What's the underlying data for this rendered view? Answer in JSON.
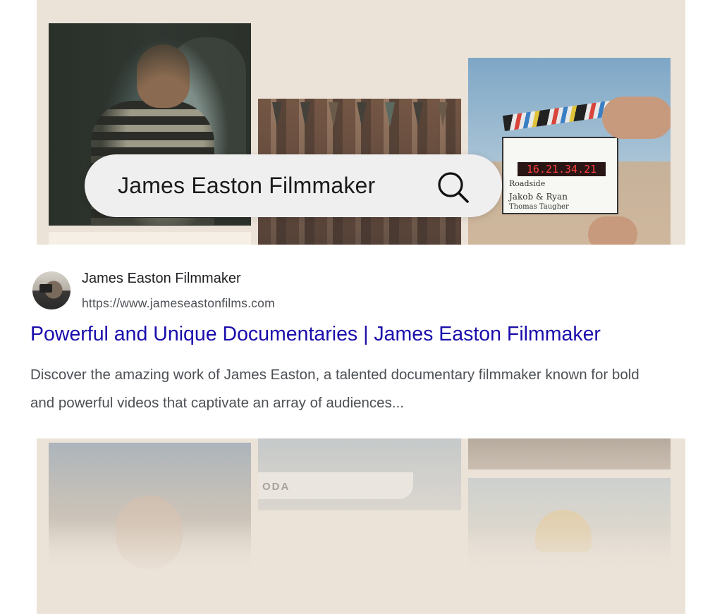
{
  "search": {
    "query": "James Easton Filmmaker"
  },
  "result": {
    "site_name": "James Easton Filmmaker",
    "url": "https://www.jameseastonfilms.com",
    "title": "Powerful and Unique Documentaries | James Easton Filmmaker",
    "description": "Discover the amazing work of James Easton, a talented documentary filmmaker known for bold and powerful videos that captivate an array of audiences..."
  },
  "photos": {
    "clapperboard_readout": "16.21.34.21",
    "clapperboard_line1": "Roadside",
    "clapperboard_line2": "Jakob & Ryan",
    "clapperboard_line3": "Thomas Taugher",
    "boat_text": "ODA"
  },
  "colors": {
    "panel_bg": "#ebe2d8",
    "link_blue": "#1a0dab",
    "desc_gray": "#4d5156"
  }
}
